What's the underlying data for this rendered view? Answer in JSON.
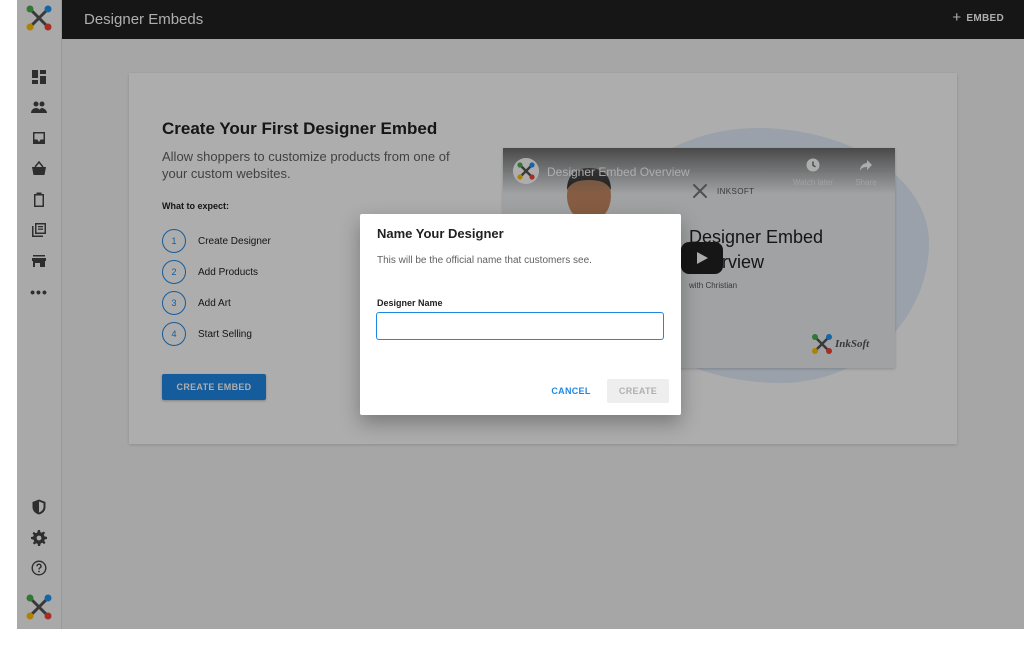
{
  "app": {
    "title": "Designer Embeds",
    "add_embed_label": "EMBED"
  },
  "sidebar": {
    "items": [
      {
        "name": "dashboard-icon"
      },
      {
        "name": "people-icon"
      },
      {
        "name": "inbox-icon"
      },
      {
        "name": "basket-icon"
      },
      {
        "name": "clipboard-icon"
      },
      {
        "name": "library-icon"
      },
      {
        "name": "store-icon"
      },
      {
        "name": "more-icon",
        "label": "•••"
      }
    ],
    "bottom_items": [
      {
        "name": "security-icon"
      },
      {
        "name": "settings-icon"
      },
      {
        "name": "help-icon"
      }
    ]
  },
  "card": {
    "heading": "Create Your First Designer Embed",
    "description": "Allow shoppers to customize products from one of your custom websites.",
    "expect_label": "What to expect:",
    "steps": [
      {
        "num": "1",
        "label": "Create Designer"
      },
      {
        "num": "2",
        "label": "Add Products"
      },
      {
        "num": "3",
        "label": "Add Art"
      },
      {
        "num": "4",
        "label": "Start Selling"
      }
    ],
    "create_button": "CREATE EMBED"
  },
  "video": {
    "title": "Designer Embed Overview",
    "watch_later": "Watch later",
    "share": "Share",
    "brand": "INKSOFT",
    "big_title_line1": "Designer Embed",
    "big_title_line2": "Overview",
    "subtitle": "with Christian",
    "logo_text": "InkSoft"
  },
  "dialog": {
    "title": "Name Your Designer",
    "subtitle": "This will be the official name that customers see.",
    "field_label": "Designer Name",
    "field_value": "",
    "cancel_label": "CANCEL",
    "create_label": "CREATE"
  },
  "colors": {
    "accent": "#1e88e5",
    "topbar": "#212121",
    "overlay": "rgba(0,0,0,0.32)"
  }
}
